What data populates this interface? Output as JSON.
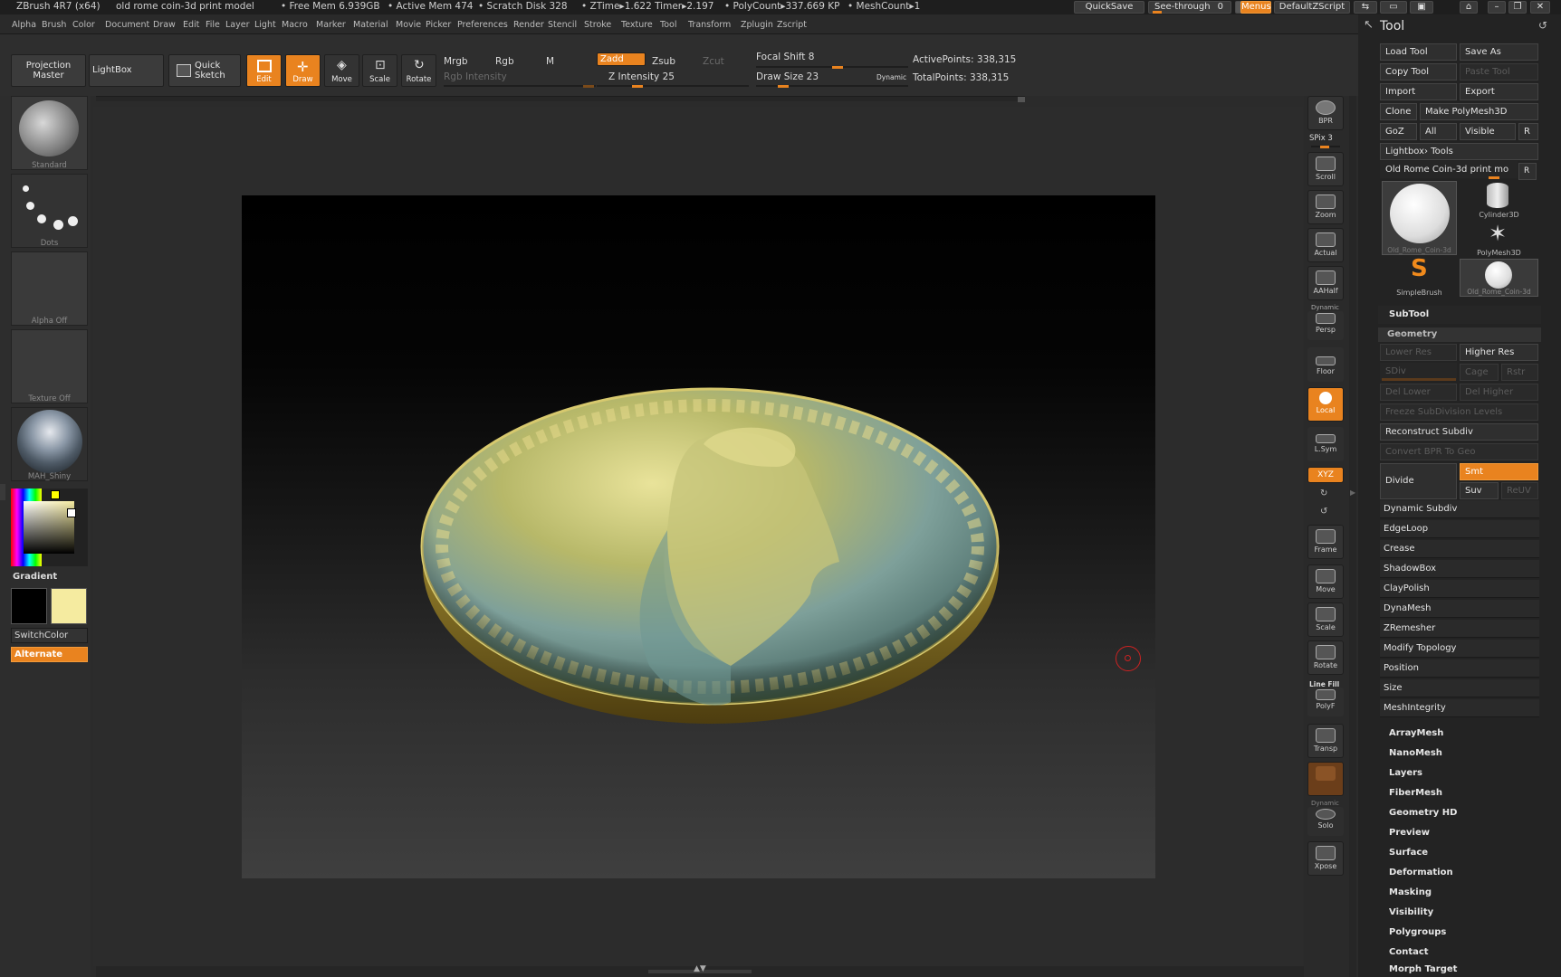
{
  "titlebar": {
    "app": "ZBrush 4R7 (x64)",
    "doc": "old rome coin-3d print model",
    "free_mem": "• Free Mem 6.939GB",
    "active_mem": "• Active Mem 474",
    "scratch": "• Scratch Disk 328",
    "ztime": "• ZTime▸1.622 Timer▸2.197",
    "polycount": "• PolyCount▸337.669 KP",
    "meshcount": "• MeshCount▸1",
    "quicksave": "QuickSave",
    "seethrough": "See-through",
    "seethrough_val": "0",
    "menus": "Menus",
    "defaultzscript": "DefaultZScript"
  },
  "menubar": [
    "Alpha",
    "Brush",
    "Color",
    "Document",
    "Draw",
    "Edit",
    "File",
    "Layer",
    "Light",
    "Macro",
    "Marker",
    "Material",
    "Movie",
    "Picker",
    "Preferences",
    "Render",
    "Stencil",
    "Stroke",
    "Texture",
    "Tool",
    "Transform",
    "Zplugin",
    "Zscript"
  ],
  "toolbar": {
    "projection_master": "Projection Master",
    "lightbox": "LightBox",
    "quick_sketch": "Quick Sketch",
    "edit": "Edit",
    "draw": "Draw",
    "move": "Move",
    "scale": "Scale",
    "rotate": "Rotate",
    "mrgb": "Mrgb",
    "rgb": "Rgb",
    "m": "M",
    "rgb_intensity": "Rgb Intensity",
    "zadd": "Zadd",
    "zsub": "Zsub",
    "zcut": "Zcut",
    "z_intensity": "Z Intensity 25",
    "z_intensity_value": 25,
    "focal_shift": "Focal Shift 8",
    "focal_shift_value": 8,
    "draw_size": "Draw Size 23",
    "draw_size_value": 23,
    "dynamic": "Dynamic",
    "active_points": "ActivePoints: 338,315",
    "total_points": "TotalPoints: 338,315"
  },
  "leftshelf": {
    "brush": "Standard",
    "stroke": "Dots",
    "alpha": "Alpha Off",
    "texture": "Texture Off",
    "material": "MAH_Shiny",
    "gradient": "Gradient",
    "switchcolor": "SwitchColor",
    "alternate": "Alternate",
    "main_color": "#000000",
    "secondary_color": "#f5eba0"
  },
  "rightshelf": {
    "bpr": "BPR",
    "spix": "SPix 3",
    "scroll": "Scroll",
    "zoom": "Zoom",
    "actual": "Actual",
    "aahalf": "AAHalf",
    "dynamic": "Dynamic",
    "persp": "Persp",
    "floor": "Floor",
    "local": "Local",
    "lsym": "L.Sym",
    "xyz": "XYZ",
    "frame": "Frame",
    "move": "Move",
    "scale": "Scale",
    "rotate": "Rotate",
    "line_fill": "Line Fill",
    "polyf": "PolyF",
    "transp": "Transp",
    "dynamic2": "Dynamic",
    "solo": "Solo",
    "xpose": "Xpose"
  },
  "toolpanel": {
    "title": "Tool",
    "load_tool": "Load Tool",
    "save_as": "Save As",
    "copy_tool": "Copy Tool",
    "paste_tool": "Paste Tool",
    "import": "Import",
    "export": "Export",
    "clone": "Clone",
    "make_polymesh": "Make PolyMesh3D",
    "goz": "GoZ",
    "all": "All",
    "visible": "Visible",
    "r": "R",
    "lightbox_tools": "Lightbox› Tools",
    "current_tool": "Old Rome Coin-3d print mo",
    "r2": "R",
    "thumbs": [
      {
        "label": "Old_Rome_Coin-3d"
      },
      {
        "label": "Cylinder3D"
      },
      {
        "label": "PolyMesh3D"
      },
      {
        "label": "SimpleBrush"
      },
      {
        "label": "Old_Rome_Coin-3d"
      }
    ],
    "subtool": "SubTool",
    "geometry": "Geometry",
    "lower_res": "Lower Res",
    "higher_res": "Higher Res",
    "sdiv": "SDiv",
    "cage": "Cage",
    "rstr": "Rstr",
    "del_lower": "Del Lower",
    "del_higher": "Del Higher",
    "freeze_subdiv": "Freeze SubDivision Levels",
    "reconstruct_subdiv": "Reconstruct Subdiv",
    "convert_bpr": "Convert BPR To Geo",
    "divide": "Divide",
    "smt": "Smt",
    "suv": "Suv",
    "reuv": "ReUV",
    "geometry_items": [
      "Dynamic Subdiv",
      "EdgeLoop",
      "Crease",
      "ShadowBox",
      "ClayPolish",
      "DynaMesh",
      "ZRemesher",
      "Modify Topology",
      "Position",
      "Size",
      "MeshIntegrity"
    ],
    "sections": [
      "ArrayMesh",
      "NanoMesh",
      "Layers",
      "FiberMesh",
      "Geometry HD",
      "Preview",
      "Surface",
      "Deformation",
      "Masking",
      "Visibility",
      "Polygroups",
      "Contact",
      "Morph Target"
    ]
  }
}
